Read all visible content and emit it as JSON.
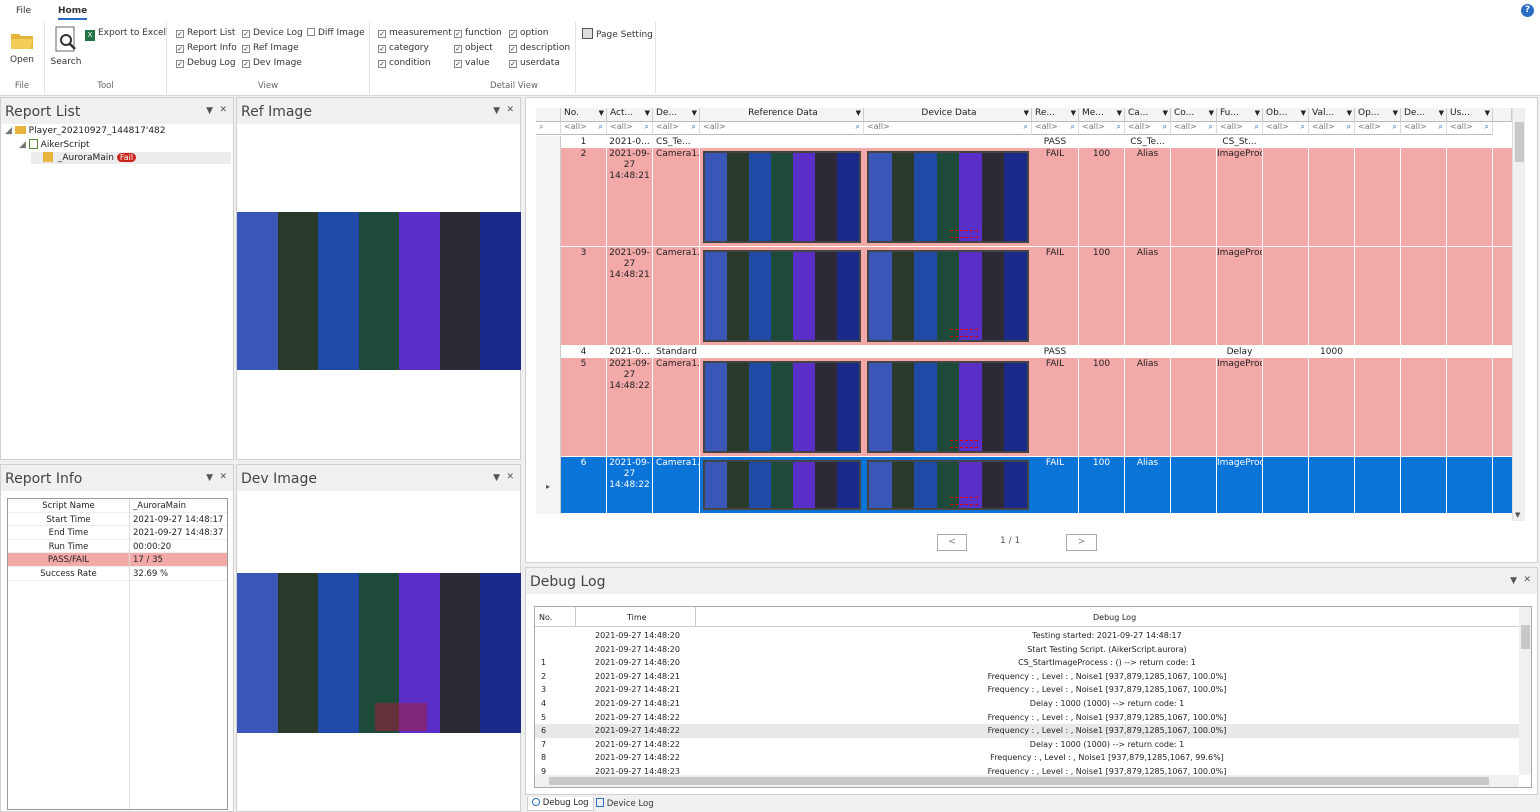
{
  "ribbon": {
    "tabs": [
      "File",
      "Home"
    ],
    "help": "?",
    "file_group": {
      "open_label": "Open",
      "group_label": "File"
    },
    "tool_group": {
      "search_label": "Search",
      "export_label": "Export to Excel",
      "group_label": "Tool"
    },
    "view_group": {
      "items": [
        "Report List",
        "Device Log",
        "Diff Image",
        "Report Info",
        "Ref Image",
        "Debug Log",
        "Dev Image"
      ],
      "checked": [
        true,
        true,
        false,
        true,
        true,
        true,
        true
      ],
      "group_label": "View"
    },
    "detail_group": {
      "items": [
        "measurement",
        "function",
        "option",
        "category",
        "object",
        "description",
        "condition",
        "value",
        "userdata"
      ],
      "group_label": "Detail View"
    },
    "page_setting_label": "Page Setting"
  },
  "report_list": {
    "title": "Report List",
    "tree": {
      "root": "Player_20210927_144817'482",
      "child": "AikerScript",
      "leaf": "_AuroraMain",
      "badge": "Fail"
    }
  },
  "ref_image": {
    "title": "Ref Image"
  },
  "dev_image": {
    "title": "Dev Image"
  },
  "report_info": {
    "title": "Report Info",
    "rows": [
      {
        "k": "Script Name",
        "v": "_AuroraMain"
      },
      {
        "k": "Start Time",
        "v": "2021-09-27 14:48:17"
      },
      {
        "k": "End Time",
        "v": "2021-09-27 14:48:37"
      },
      {
        "k": "Run Time",
        "v": "00:00:20"
      },
      {
        "k": "PASS/FAIL",
        "v": "17 / 35"
      },
      {
        "k": "Success Rate",
        "v": "32.69 %"
      }
    ]
  },
  "grid": {
    "headers": [
      "No.",
      "Act...",
      "De...",
      "Reference Data",
      "Device Data",
      "Re...",
      "Me...",
      "Ca...",
      "Co...",
      "Fu...",
      "Ob...",
      "Val...",
      "Op...",
      "De...",
      "Us..."
    ],
    "filter_all": "<all>",
    "rows": [
      {
        "no": "1",
        "act": "2021-0...",
        "de": "CS_Te...",
        "re": "PASS",
        "me": "",
        "ca": "CS_Te...",
        "fu": "CS_St...",
        "val": "",
        "status": "pass"
      },
      {
        "no": "2",
        "act": "2021-09-27 14:48:21",
        "de": "Camera1.dll",
        "re": "FAIL",
        "me": "100",
        "ca": "Alias",
        "fu": "ImageProcess",
        "val": "",
        "status": "fail"
      },
      {
        "no": "3",
        "act": "2021-09-27 14:48:21",
        "de": "Camera1.dll",
        "re": "FAIL",
        "me": "100",
        "ca": "Alias",
        "fu": "ImageProcess",
        "val": "",
        "status": "fail"
      },
      {
        "no": "4",
        "act": "2021-0...",
        "de": "Standard",
        "re": "PASS",
        "me": "",
        "ca": "",
        "fu": "Delay",
        "val": "1000",
        "status": "pass"
      },
      {
        "no": "5",
        "act": "2021-09-27 14:48:22",
        "de": "Camera1.dll",
        "re": "FAIL",
        "me": "100",
        "ca": "Alias",
        "fu": "ImageProcess",
        "val": "",
        "status": "fail"
      },
      {
        "no": "6",
        "act": "2021-09-27 14:48:22",
        "de": "Camera1.dll",
        "re": "FAIL",
        "me": "100",
        "ca": "Alias",
        "fu": "ImageProcess",
        "val": "",
        "status": "selected"
      }
    ],
    "pager": {
      "prev": "<",
      "page": "1 / 1",
      "next": ">"
    }
  },
  "debug_log": {
    "title": "Debug Log",
    "col_no": "No.",
    "col_time": "Time",
    "col_log": "Debug Log",
    "rows": [
      {
        "no": "",
        "time": "2021-09-27 14:48:20",
        "log": "Testing started: 2021-09-27 14:48:17"
      },
      {
        "no": "",
        "time": "2021-09-27 14:48:20",
        "log": "Start Testing Script. (AikerScript.aurora)"
      },
      {
        "no": "1",
        "time": "2021-09-27 14:48:20",
        "log": "CS_StartImageProcess : () --> return code: 1"
      },
      {
        "no": "2",
        "time": "2021-09-27 14:48:21",
        "log": "Frequency : , Level : , Noise1 [937,879,1285,1067, 100.0%]"
      },
      {
        "no": "3",
        "time": "2021-09-27 14:48:21",
        "log": "Frequency : , Level : , Noise1 [937,879,1285,1067, 100.0%]"
      },
      {
        "no": "4",
        "time": "2021-09-27 14:48:21",
        "log": "Delay : 1000 (1000) --> return code: 1"
      },
      {
        "no": "5",
        "time": "2021-09-27 14:48:22",
        "log": "Frequency : , Level : , Noise1 [937,879,1285,1067, 100.0%]"
      },
      {
        "no": "6",
        "time": "2021-09-27 14:48:22",
        "log": "Frequency : , Level : , Noise1 [937,879,1285,1067, 100.0%]"
      },
      {
        "no": "7",
        "time": "2021-09-27 14:48:22",
        "log": "Delay : 1000 (1000) --> return code: 1"
      },
      {
        "no": "8",
        "time": "2021-09-27 14:48:22",
        "log": "Frequency : , Level : , Noise1 [937,879,1285,1067, 99.6%]"
      },
      {
        "no": "9",
        "time": "2021-09-27 14:48:23",
        "log": "Frequency : , Level : , Noise1 [937,879,1285,1067, 100.0%]"
      }
    ],
    "tabs": [
      "Debug Log",
      "Device Log"
    ]
  },
  "colors": {
    "fail_row": "#f4a9a9",
    "selected_row": "#0a74d8",
    "accent": "#2b6cc4",
    "stripes": [
      "#3a57b8",
      "#2a3a2a",
      "#1f4aa6",
      "#1e4a3a",
      "#5a2fc8",
      "#2e2a35",
      "#1a2a8a"
    ]
  }
}
